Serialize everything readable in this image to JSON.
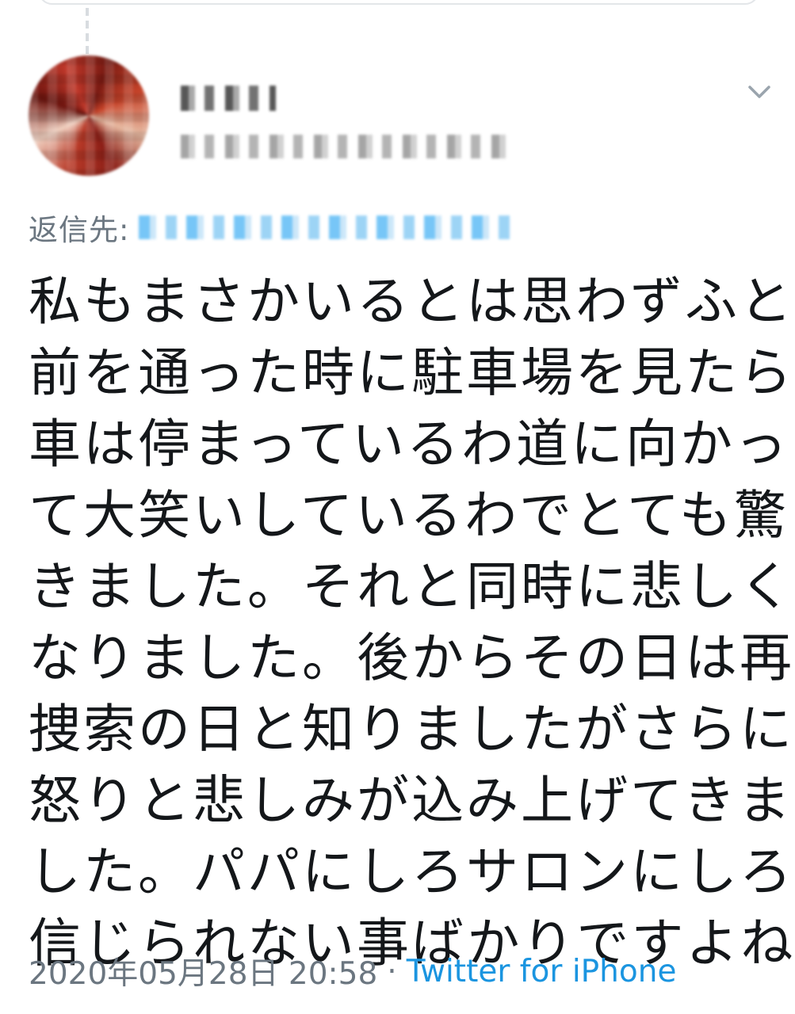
{
  "tweet": {
    "reply_prefix": "返信先:",
    "text_lines": [
      "私もまさかいるとは思わずふと",
      "前を通った時に駐車場を見たら",
      "車は停まっているわ道に向かっ",
      "て大笑いしているわでとても驚",
      "きました。それと同時に悲しく",
      "なりました。後からその日は再",
      "捜索の日と知りましたがさらに",
      "怒りと悲しみが込み上げてきま",
      "した。パパにしろサロンにしろ",
      "信じられない事ばかりですよね"
    ],
    "timestamp": "2020年05月28日 20:58",
    "separator": "·",
    "source": "Twitter for iPhone"
  },
  "icons": {
    "menu": "chevron-down-icon",
    "avatar": "avatar-pixelated"
  },
  "colors": {
    "text": "#14171a",
    "secondary": "#6b7680",
    "link": "#1b95e0"
  }
}
